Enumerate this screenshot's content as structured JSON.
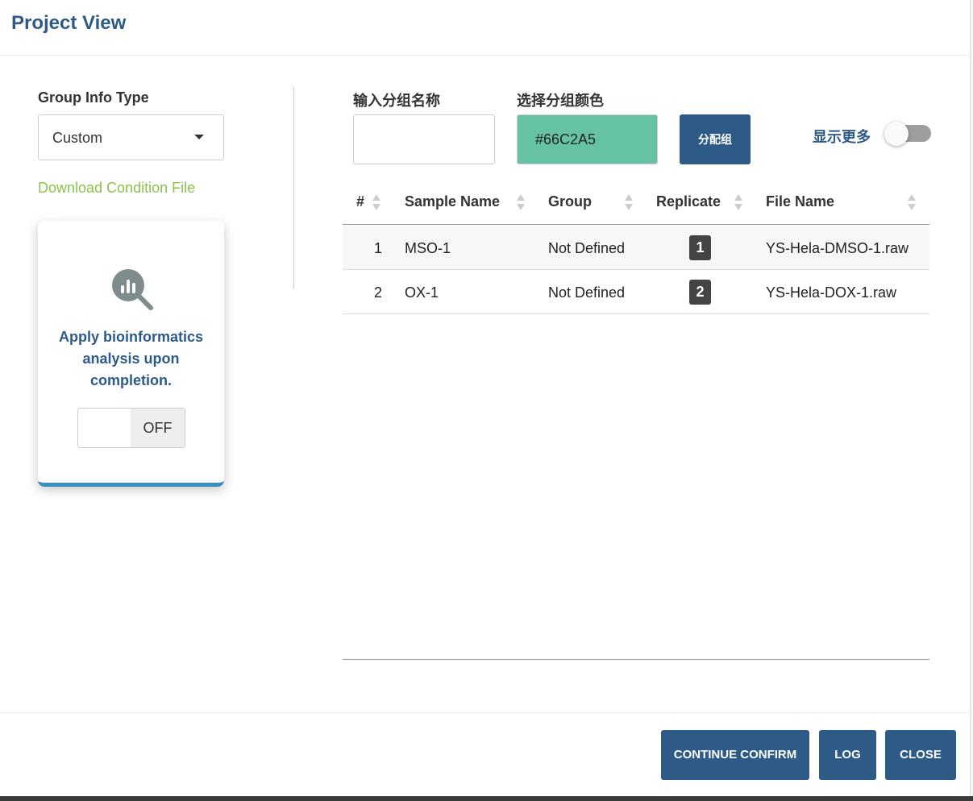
{
  "header": {
    "title": "Project View"
  },
  "left": {
    "group_info_label": "Group Info Type",
    "group_info_value": "Custom",
    "download_link": "Download Condition File",
    "card": {
      "icon": "analytics-search-icon",
      "text": "Apply bioinformatics analysis upon completion.",
      "toggle_state": "OFF"
    }
  },
  "controls": {
    "group_name_label": "输入分组名称",
    "group_name_value": "",
    "group_color_label": "选择分组颜色",
    "group_color_value": "#66C2A5",
    "assign_button": "分配组",
    "show_more_label": "显示更多",
    "show_more_on": false
  },
  "table": {
    "columns": [
      "#",
      "Sample Name",
      "Group",
      "Replicate",
      "File Name"
    ],
    "rows": [
      {
        "index": "1",
        "sample": "MSO-1",
        "group": "Not Defined",
        "replicate": "1",
        "file": "YS-Hela-DMSO-1.raw"
      },
      {
        "index": "2",
        "sample": "OX-1",
        "group": "Not Defined",
        "replicate": "2",
        "file": "YS-Hela-DOX-1.raw"
      }
    ]
  },
  "footer": {
    "continue_label": "CONTINUE CONFIRM",
    "log_label": "LOG",
    "close_label": "CLOSE"
  },
  "colors": {
    "brand": "#2d5a87",
    "link_green": "#8bc34a",
    "card_accent": "#3b8ec0"
  }
}
